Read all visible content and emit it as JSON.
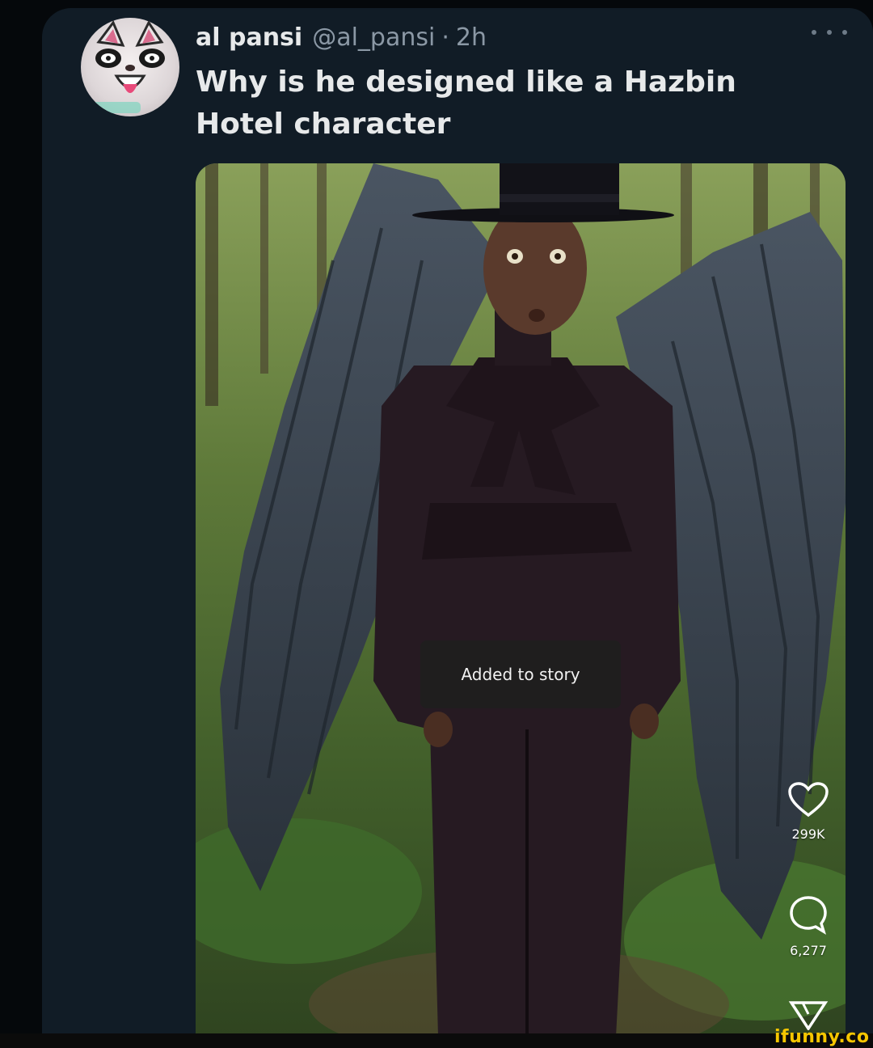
{
  "tweet": {
    "display_name": "al pansi",
    "handle": "@al_pansi",
    "separator": "·",
    "time": "2h",
    "text": "Why is he designed like a Hazbin Hotel character",
    "avatar_icon": "cartoon-cat-avatar",
    "more_icon": "more-options-icon"
  },
  "media": {
    "toast_text": "Added to story",
    "hat_logo": "ϟ",
    "actions": {
      "like_icon": "heart-icon",
      "like_count": "299K",
      "comment_icon": "comment-icon",
      "comment_count": "6,277",
      "share_icon": "share-icon"
    }
  },
  "watermark": "ifunny.co",
  "colors": {
    "card_background": "#111c26",
    "primary_text": "#e7e9ea",
    "secondary_text": "#8b98a5",
    "watermark": "#f5c600"
  }
}
